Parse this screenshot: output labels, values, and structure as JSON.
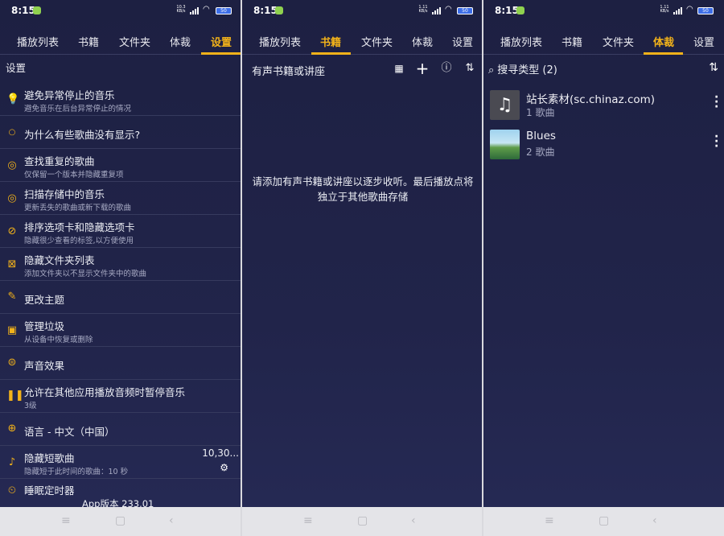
{
  "status": {
    "time": "8:15",
    "speed_1": "10.3 KB/s",
    "speed_2": "1.11 KB/s",
    "speed_3": "1.11 KB/s",
    "network": "5G",
    "battery": "50"
  },
  "tabs": [
    "播放列表",
    "书籍",
    "文件夹",
    "体裁",
    "设置"
  ],
  "settings": {
    "title": "设置",
    "items": [
      {
        "icon": "lightbulb-icon",
        "title": "避免异常停止的音乐",
        "subtitle": "避免音乐在后台异常停止的情况"
      },
      {
        "icon": "chat-bubble-icon",
        "title": "为什么有些歌曲没有显示?",
        "subtitle": ""
      },
      {
        "icon": "search-music-icon",
        "title": "查找重复的歌曲",
        "subtitle": "仅保留一个版本并隐藏重复项"
      },
      {
        "icon": "scan-music-icon",
        "title": "扫描存储中的音乐",
        "subtitle": "更新丢失的歌曲或新下载的歌曲"
      },
      {
        "icon": "eye-off-icon",
        "title": "排序选项卡和隐藏选项卡",
        "subtitle": "隐藏很少查看的标签,以方便使用"
      },
      {
        "icon": "folder-hide-icon",
        "title": "隐藏文件夹列表",
        "subtitle": "添加文件夹以不显示文件夹中的歌曲"
      },
      {
        "icon": "brush-icon",
        "title": "更改主题",
        "subtitle": ""
      },
      {
        "icon": "trash-icon",
        "title": "管理垃圾",
        "subtitle": "从设备中恢复或删除"
      },
      {
        "icon": "equalizer-icon",
        "title": "声音效果",
        "subtitle": ""
      },
      {
        "icon": "pause-icon",
        "title": "允许在其他应用播放音频时暂停音乐",
        "subtitle": "3级"
      },
      {
        "icon": "globe-icon",
        "title": "语言 - 中文（中国）",
        "subtitle": ""
      },
      {
        "icon": "short-song-icon",
        "title": "隐藏短歌曲",
        "subtitle": "隐藏短于此时间的歌曲：10 秒"
      },
      {
        "icon": "sleep-timer-icon",
        "title": "睡眠定时器",
        "subtitle": ""
      }
    ],
    "side_value": "10,30...",
    "version": "App版本 233.01"
  },
  "books": {
    "header": "有声书籍或讲座",
    "empty_message": "请添加有声书籍或讲座以逐步收听。最后播放点将独立于其他歌曲存储"
  },
  "genres": {
    "search_label": "搜寻类型 (2)",
    "items": [
      {
        "name": "站长素材(sc.chinaz.com)",
        "count": "1 歌曲",
        "thumb": "music-note-icon"
      },
      {
        "name": "Blues",
        "count": "2 歌曲",
        "thumb": "album-art-landscape"
      }
    ]
  },
  "colors": {
    "accent": "#f2b21a",
    "background": "#1d2042",
    "navbar": "#e4e4e8"
  }
}
